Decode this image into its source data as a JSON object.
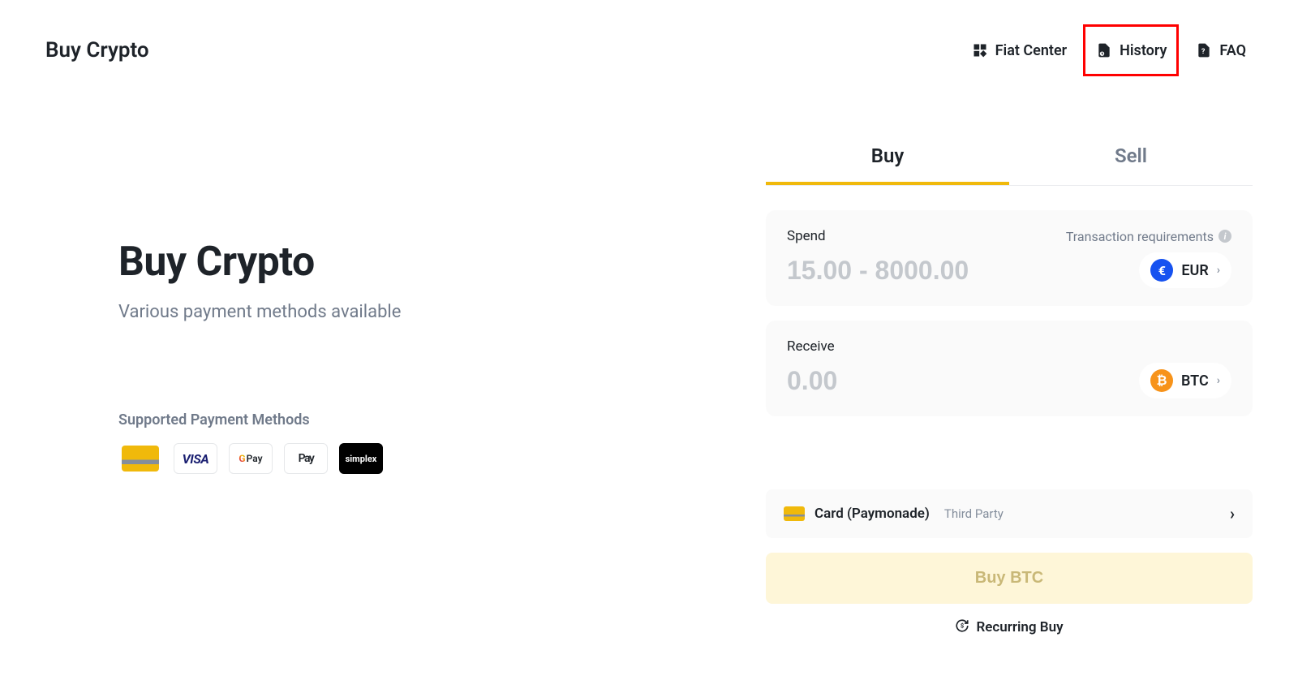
{
  "header": {
    "title": "Buy Crypto",
    "nav": {
      "fiat_center": "Fiat Center",
      "history": "History",
      "faq": "FAQ"
    }
  },
  "hero": {
    "title": "Buy Crypto",
    "subtitle": "Various payment methods available",
    "supported_title": "Supported Payment Methods",
    "methods": {
      "visa": "VISA",
      "gpay": "G Pay",
      "apple_pay": "Pay",
      "simplex": "simplex"
    }
  },
  "tabs": {
    "buy": "Buy",
    "sell": "Sell"
  },
  "spend": {
    "label": "Spend",
    "tx_req": "Transaction requirements",
    "placeholder": "15.00 - 8000.00",
    "currency": "EUR",
    "currency_symbol": "€"
  },
  "receive": {
    "label": "Receive",
    "placeholder": "0.00",
    "currency": "BTC",
    "currency_symbol": "₿"
  },
  "payment": {
    "name": "Card (Paymonade)",
    "tag": "Third Party"
  },
  "buy_button": "Buy BTC",
  "recurring": "Recurring Buy"
}
